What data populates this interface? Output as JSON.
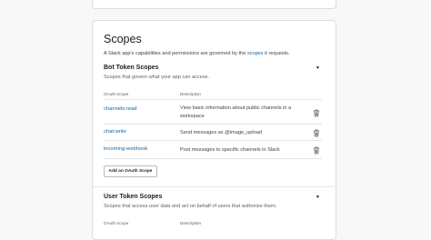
{
  "page": {
    "title": "Scopes",
    "intro_prefix": "A Slack app’s capabilities and permissions are governed by the ",
    "intro_link": "scopes",
    "intro_suffix": " it requests."
  },
  "bot_section": {
    "title": "Bot Token Scopes",
    "description": "Scopes that govern what your app can access.",
    "col_scope": "OAuth Scope",
    "col_description": "Description",
    "rows": [
      {
        "scope": "channels:read",
        "description": "View basic information about public channels in a workspace"
      },
      {
        "scope": "chat:write",
        "description": "Send messages as @image_upload"
      },
      {
        "scope": "incoming-webhook",
        "description": "Post messages to specific channels in Slack"
      }
    ],
    "add_button": "Add an OAuth Scope"
  },
  "user_section": {
    "title": "User Token Scopes",
    "description": "Scopes that access user data and act on behalf of users that authorize them.",
    "col_scope": "OAuth Scope",
    "col_description": "Description"
  },
  "icons": {
    "caret": "caret-down-icon",
    "remove": "trash-icon"
  },
  "colors": {
    "link": "#1264a3",
    "text": "#1d1c1d",
    "background": "#f8f8f8"
  }
}
